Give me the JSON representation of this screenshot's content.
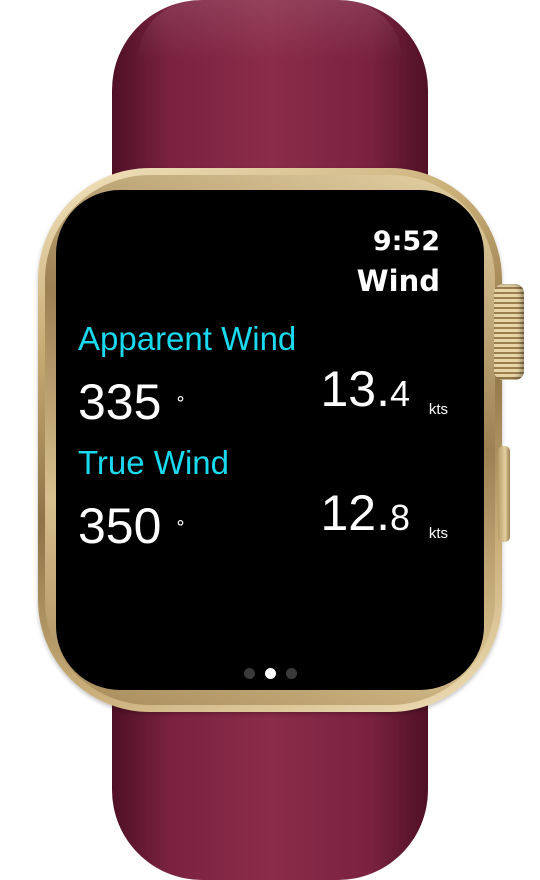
{
  "status": {
    "time": "9:52"
  },
  "app": {
    "title": "Wind"
  },
  "apparent_wind": {
    "label": "Apparent Wind",
    "direction": "335",
    "direction_unit": "°",
    "speed_whole": "13",
    "speed_dot": ".",
    "speed_frac": "4",
    "speed_unit": "kts"
  },
  "true_wind": {
    "label": "True Wind",
    "direction": "350",
    "direction_unit": "°",
    "speed_whole": "12",
    "speed_dot": ".",
    "speed_frac": "8",
    "speed_unit": "kts"
  },
  "pager": {
    "page_count": 3,
    "active_index": 1
  },
  "colors": {
    "accent": "#19d9ee",
    "band": "#7a2240",
    "case": "#c9ad76",
    "screen": "#000000"
  }
}
